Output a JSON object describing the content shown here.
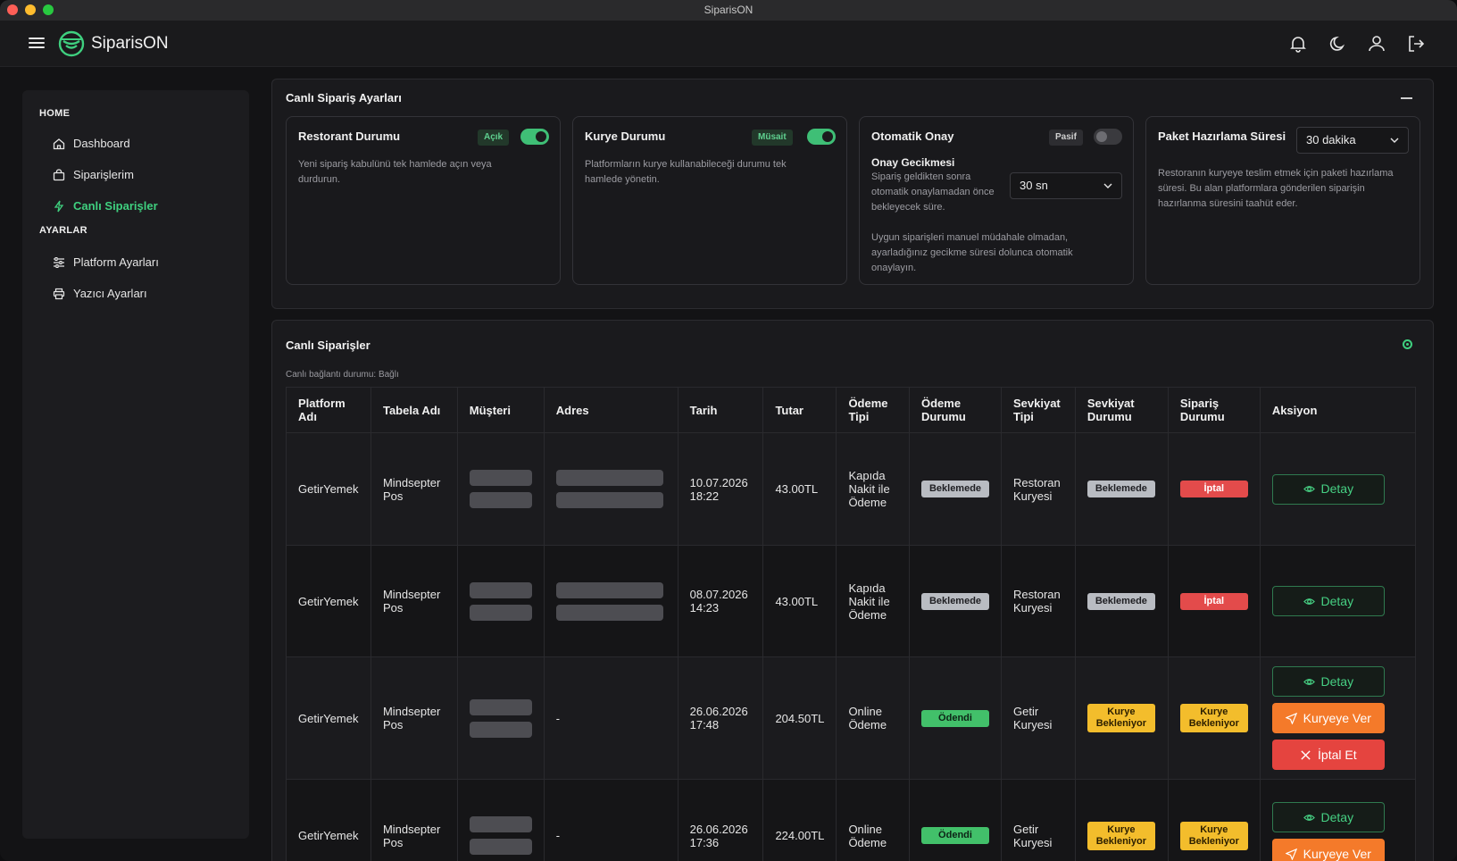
{
  "window": {
    "title": "SiparisON"
  },
  "app": {
    "name": "SiparisON"
  },
  "sidebar": {
    "sections": [
      {
        "label": "HOME",
        "items": [
          {
            "label": "Dashboard",
            "icon": "home-icon"
          },
          {
            "label": "Siparişlerim",
            "icon": "bag-icon"
          },
          {
            "label": "Canlı Siparişler",
            "icon": "bolt-icon",
            "active": true
          }
        ]
      },
      {
        "label": "AYARLAR",
        "items": [
          {
            "label": "Platform Ayarları",
            "icon": "sliders-icon"
          },
          {
            "label": "Yazıcı Ayarları",
            "icon": "printer-icon"
          }
        ]
      }
    ]
  },
  "settings": {
    "title": "Canlı Sipariş Ayarları",
    "restaurant": {
      "title": "Restorant Durumu",
      "badge": "Açık",
      "toggle_on": true,
      "desc": "Yeni sipariş kabulünü tek hamlede açın veya durdurun."
    },
    "courier": {
      "title": "Kurye Durumu",
      "badge": "Müsait",
      "toggle_on": true,
      "desc": "Platformların kurye kullanabileceği durumu tek hamlede yönetin."
    },
    "auto_approve": {
      "title": "Otomatik Onay",
      "badge": "Pasif",
      "toggle_on": false,
      "delay_title": "Onay Gecikmesi",
      "delay_desc": "Sipariş geldikten sonra otomatik onaylamadan önce bekleyecek süre.",
      "delay_value": "30 sn",
      "desc": "Uygun siparişleri manuel müdahale olmadan, ayarladığınız gecikme süresi dolunca otomatik onaylayın."
    },
    "prep_time": {
      "title": "Paket Hazırlama Süresi",
      "value": "30 dakika",
      "desc": "Restoranın kuryeye teslim etmek için paketi hazırlama süresi. Bu alan platformlara gönderilen siparişin hazırlanma süresini taahüt eder."
    }
  },
  "orders": {
    "title": "Canlı Siparişler",
    "connection_status": "Canlı bağlantı durumu: Bağlı",
    "columns": [
      "Platform Adı",
      "Tabela Adı",
      "Müşteri",
      "Adres",
      "Tarih",
      "Tutar",
      "Ödeme Tipi",
      "Ödeme Durumu",
      "Sevkiyat Tipi",
      "Sevkiyat Durumu",
      "Sipariş Durumu",
      "Aksiyon"
    ],
    "rows": [
      {
        "platform": "GetirYemek",
        "store": "Mindsepter Pos",
        "date": "10.07.2026 18:22",
        "amount": "43.00TL",
        "pay_type": "Kapıda Nakit ile Ödeme",
        "pay_status": "Beklemede",
        "ship_type": "Restoran Kuryesi",
        "ship_status": "Beklemede",
        "order_status": "İptal",
        "address_redacted": true,
        "actions": [
          "Detay"
        ]
      },
      {
        "platform": "GetirYemek",
        "store": "Mindsepter Pos",
        "date": "08.07.2026 14:23",
        "amount": "43.00TL",
        "pay_type": "Kapıda Nakit ile Ödeme",
        "pay_status": "Beklemede",
        "ship_type": "Restoran Kuryesi",
        "ship_status": "Beklemede",
        "order_status": "İptal",
        "address_redacted": true,
        "actions": [
          "Detay"
        ]
      },
      {
        "platform": "GetirYemek",
        "store": "Mindsepter Pos",
        "date": "26.06.2026 17:48",
        "amount": "204.50TL",
        "pay_type": "Online Ödeme",
        "pay_status": "Ödendi",
        "ship_type": "Getir Kuryesi",
        "ship_status": "Kurye Bekleniyor",
        "order_status": "Kurye Bekleniyor",
        "address": "-",
        "actions": [
          "Detay",
          "Kuryeye Ver",
          "İptal Et"
        ]
      },
      {
        "platform": "GetirYemek",
        "store": "Mindsepter Pos",
        "date": "26.06.2026 17:36",
        "amount": "224.00TL",
        "pay_type": "Online Ödeme",
        "pay_status": "Ödendi",
        "ship_type": "Getir Kuryesi",
        "ship_status": "Kurye Bekleniyor",
        "order_status": "Kurye Bekleniyor",
        "address": "-",
        "actions": [
          "Detay",
          "Kuryeye Ver"
        ]
      }
    ]
  },
  "colors": {
    "accent": "#3fd07f",
    "danger": "#e34b4b",
    "warning": "#f3bd2c",
    "orange": "#f47a2a"
  }
}
